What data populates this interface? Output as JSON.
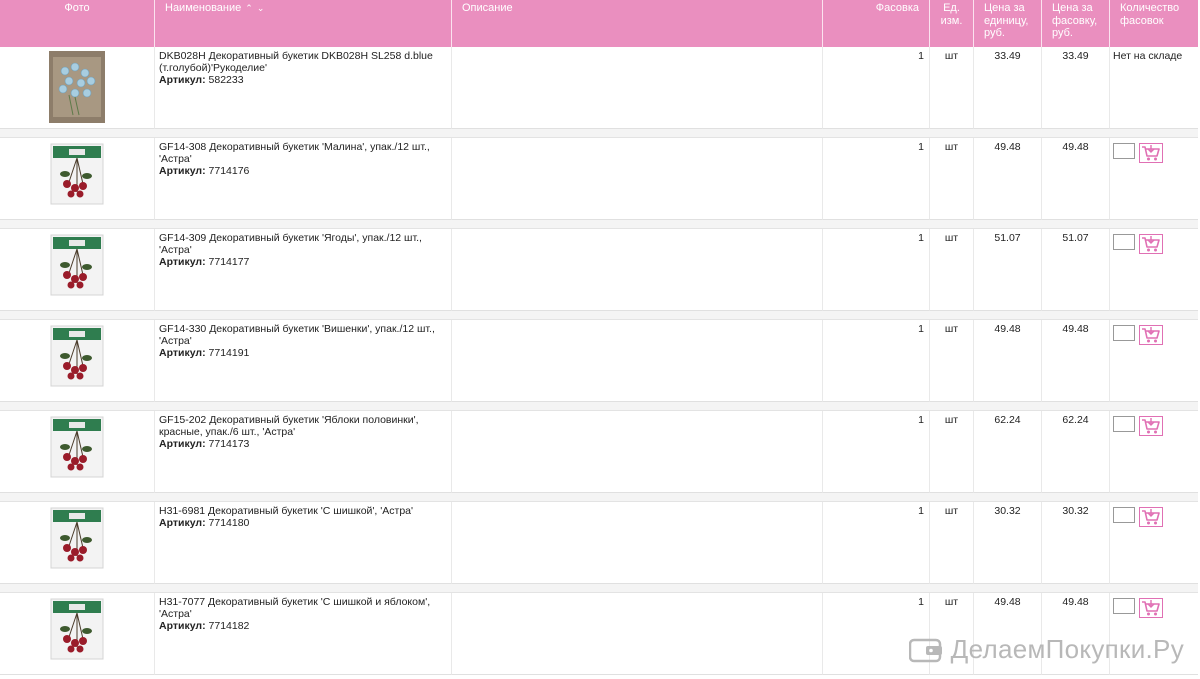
{
  "header": {
    "photo": "Фото",
    "name": "Наименование",
    "sort_up": "⌃",
    "sort_down": "⌄",
    "description": "Описание",
    "pack": "Фасовка",
    "unit": "Ед. изм.",
    "price_unit": "Цена за единицу, руб.",
    "price_pack": "Цена за фасовку, руб.",
    "qty": "Количество фасовок"
  },
  "colors": {
    "header_bg": "#ea8fbf",
    "cart": "#e070b4"
  },
  "sku_label": "Артикул:",
  "rows": [
    {
      "name": "DKB028H Декоративный букетик DKB028H SL258 d.blue (т.голубой)'Рукоделие'",
      "sku": "582233",
      "pack": "1",
      "unit": "шт",
      "price_unit": "33.49",
      "price_pack": "33.49",
      "stock": "Нет на складе",
      "photo_icon": "blue-flowers"
    },
    {
      "name": "GF14-308 Декоративный букетик 'Малина', упак./12 шт., 'Астра'",
      "sku": "7714176",
      "pack": "1",
      "unit": "шт",
      "price_unit": "49.48",
      "price_pack": "49.48",
      "stock": "",
      "photo_icon": "berries-pack"
    },
    {
      "name": "GF14-309 Декоративный букетик 'Ягоды', упак./12 шт., 'Астра'",
      "sku": "7714177",
      "pack": "1",
      "unit": "шт",
      "price_unit": "51.07",
      "price_pack": "51.07",
      "stock": "",
      "photo_icon": "berries-pack"
    },
    {
      "name": "GF14-330 Декоративный букетик 'Вишенки', упак./12 шт., 'Астра'",
      "sku": "7714191",
      "pack": "1",
      "unit": "шт",
      "price_unit": "49.48",
      "price_pack": "49.48",
      "stock": "",
      "photo_icon": "berries-pack"
    },
    {
      "name": "GF15-202 Декоративный букетик 'Яблоки половинки', красные, упак./6 шт., 'Астра'",
      "sku": "7714173",
      "pack": "1",
      "unit": "шт",
      "price_unit": "62.24",
      "price_pack": "62.24",
      "stock": "",
      "photo_icon": "berries-pack"
    },
    {
      "name": "H31-6981 Декоративный букетик 'С шишкой', 'Астра'",
      "sku": "7714180",
      "pack": "1",
      "unit": "шт",
      "price_unit": "30.32",
      "price_pack": "30.32",
      "stock": "",
      "photo_icon": "berries-pack"
    },
    {
      "name": "H31-7077 Декоративный букетик 'С шишкой и яблоком', 'Астра'",
      "sku": "7714182",
      "pack": "1",
      "unit": "шт",
      "price_unit": "49.48",
      "price_pack": "49.48",
      "stock": "",
      "photo_icon": "berries-pack"
    }
  ],
  "watermark": "ДелаемПокупки.Ру"
}
